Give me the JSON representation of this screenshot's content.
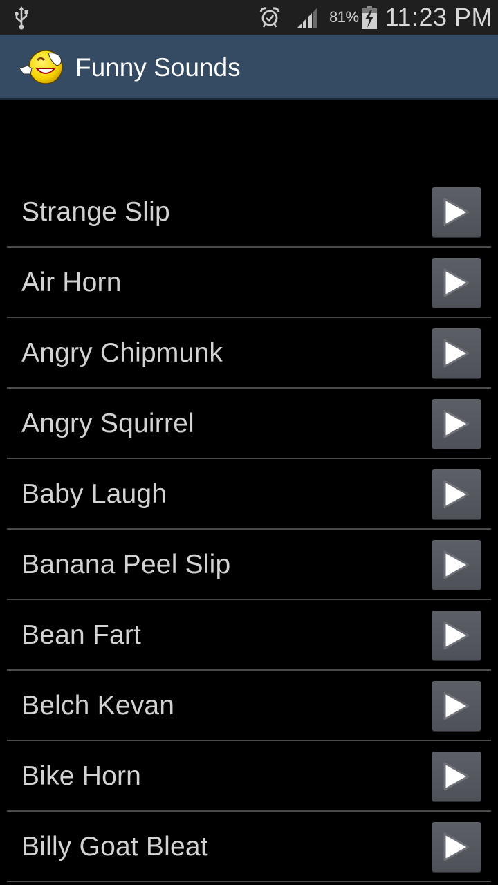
{
  "status_bar": {
    "left_icons": [
      "usb-icon"
    ],
    "right_icons": [
      "alarm-icon",
      "signal-icon",
      "battery-charging-icon"
    ],
    "battery_percent": "81%",
    "time": "11:23 PM"
  },
  "action_bar": {
    "app_icon": "laughing-smiley-icon",
    "title": "Funny Sounds",
    "background_color": "#344b63"
  },
  "sounds": [
    {
      "label": "Strange Slip",
      "button_icon": "play-icon"
    },
    {
      "label": "Air Horn",
      "button_icon": "play-icon"
    },
    {
      "label": "Angry Chipmunk",
      "button_icon": "play-icon"
    },
    {
      "label": "Angry Squirrel",
      "button_icon": "play-icon"
    },
    {
      "label": "Baby Laugh",
      "button_icon": "play-icon"
    },
    {
      "label": "Banana Peel Slip",
      "button_icon": "play-icon"
    },
    {
      "label": "Bean Fart",
      "button_icon": "play-icon"
    },
    {
      "label": "Belch Kevan",
      "button_icon": "play-icon"
    },
    {
      "label": "Bike Horn",
      "button_icon": "play-icon"
    },
    {
      "label": "Billy Goat Bleat",
      "button_icon": "play-icon"
    }
  ]
}
